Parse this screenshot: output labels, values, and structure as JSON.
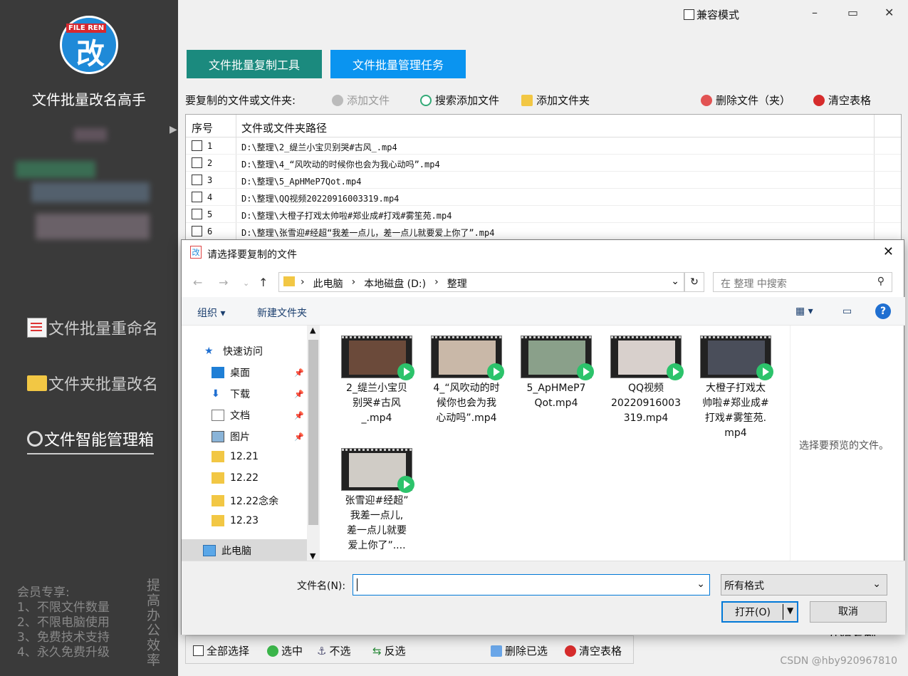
{
  "app": {
    "logo_tag": "FILE REN",
    "logo_glyph": "改",
    "title": "文件批量改名高手",
    "nav": [
      "文件批量重命名",
      "文件夹批量改名",
      "文件智能管理箱"
    ],
    "member_lines": [
      "会员专享:",
      "1、不限文件数量",
      "2、不限电脑使用",
      "3、免费技术支持",
      "4、永久免费升级"
    ],
    "slogan": "提高办公效率"
  },
  "window": {
    "compat_label": "兼容模式",
    "minimize": "–",
    "maximize": "▭",
    "close": "✕"
  },
  "tabs": [
    "文件批量复制工具",
    "文件批量管理任务"
  ],
  "toolbar": {
    "label": "要复制的文件或文件夹:",
    "add_file": "添加文件",
    "search_add": "搜索添加文件",
    "add_folder": "添加文件夹",
    "delete": "删除文件（夹）",
    "clear": "清空表格"
  },
  "grid": {
    "col_index": "序号",
    "col_path": "文件或文件夹路径",
    "rows": [
      {
        "num": "1",
        "path": "D:\\整理\\2_缇兰小宝贝别哭#古风_.mp4"
      },
      {
        "num": "2",
        "path": "D:\\整理\\4_“风吹动的时候你也会为我心动吗”.mp4"
      },
      {
        "num": "3",
        "path": "D:\\整理\\5_ApHMeP7Qot.mp4"
      },
      {
        "num": "4",
        "path": "D:\\整理\\QQ视频20220916003319.mp4"
      },
      {
        "num": "5",
        "path": "D:\\整理\\大橙子打戏太帅啦#郑业成#打戏#雾笙苑.mp4"
      },
      {
        "num": "6",
        "path": "D:\\整理\\张雪迎#经超“我差一点儿，差一点儿就要爱上你了”.mp4"
      }
    ]
  },
  "bottombar": {
    "select_all": "全部选择",
    "check": "选中",
    "uncheck": "不选",
    "invert": "反选",
    "delete_selected": "删除已选",
    "clear": "清空表格"
  },
  "start_fragment": "开始复制",
  "watermark": "CSDN @hby920967810",
  "dialog": {
    "title": "请选择要复制的文件",
    "breadcrumbs": [
      "此电脑",
      "本地磁盘 (D:)",
      "整理"
    ],
    "search_placeholder": "在 整理 中搜索",
    "organize": "组织 ▾",
    "new_folder": "新建文件夹",
    "nav_items": [
      {
        "label": "快速访问",
        "icon": "star-icon"
      },
      {
        "label": "桌面",
        "icon": "desktop-icon",
        "pinned": true
      },
      {
        "label": "下载",
        "icon": "download-icon",
        "pinned": true
      },
      {
        "label": "文档",
        "icon": "document-icon",
        "pinned": true
      },
      {
        "label": "图片",
        "icon": "picture-icon",
        "pinned": true
      },
      {
        "label": "12.21",
        "icon": "folder-icon"
      },
      {
        "label": "12.22",
        "icon": "folder-icon"
      },
      {
        "label": "12.22念余",
        "icon": "folder-icon"
      },
      {
        "label": "12.23",
        "icon": "folder-icon"
      },
      {
        "label": "此电脑",
        "icon": "computer-icon"
      }
    ],
    "files": [
      {
        "name": "2_缇兰小宝贝别哭#古风_.mp4",
        "lines": [
          "2_缇兰小宝贝",
          "别哭#古风",
          "_.mp4"
        ],
        "tone": "#6b4a3a"
      },
      {
        "name": "4_“风吹动的时候你也会为我心动吗”.mp4",
        "lines": [
          "4_“风吹动的时",
          "候你也会为我",
          "心动吗”.mp4"
        ],
        "tone": "#c9b8a8"
      },
      {
        "name": "5_ApHMeP7Qot.mp4",
        "lines": [
          "5_ApHMeP7",
          "Qot.mp4"
        ],
        "tone": "#8aa08a"
      },
      {
        "name": "QQ视频20220916003319.mp4",
        "lines": [
          "QQ视频",
          "20220916003",
          "319.mp4"
        ],
        "tone": "#d8d0cc"
      },
      {
        "name": "大橙子打戏太帅啦#郑业成#打戏#雾笙苑.mp4",
        "lines": [
          "大橙子打戏太",
          "帅啦#郑业成#",
          "打戏#雾笙苑.",
          "mp4"
        ],
        "tone": "#4a4e5a"
      },
      {
        "name": "张雪迎#经超“我差一点儿，差一点儿就要爱上你了”....",
        "lines": [
          "张雪迎#经超”",
          "我差一点儿,",
          "差一点儿就要",
          "爱上你了”...."
        ],
        "tone": "#d0ccc6"
      }
    ],
    "preview_text": "选择要预览的文件。",
    "filename_label": "文件名(N):",
    "filename_value": "",
    "filter": "所有格式",
    "open": "打开(O)",
    "cancel": "取消"
  }
}
